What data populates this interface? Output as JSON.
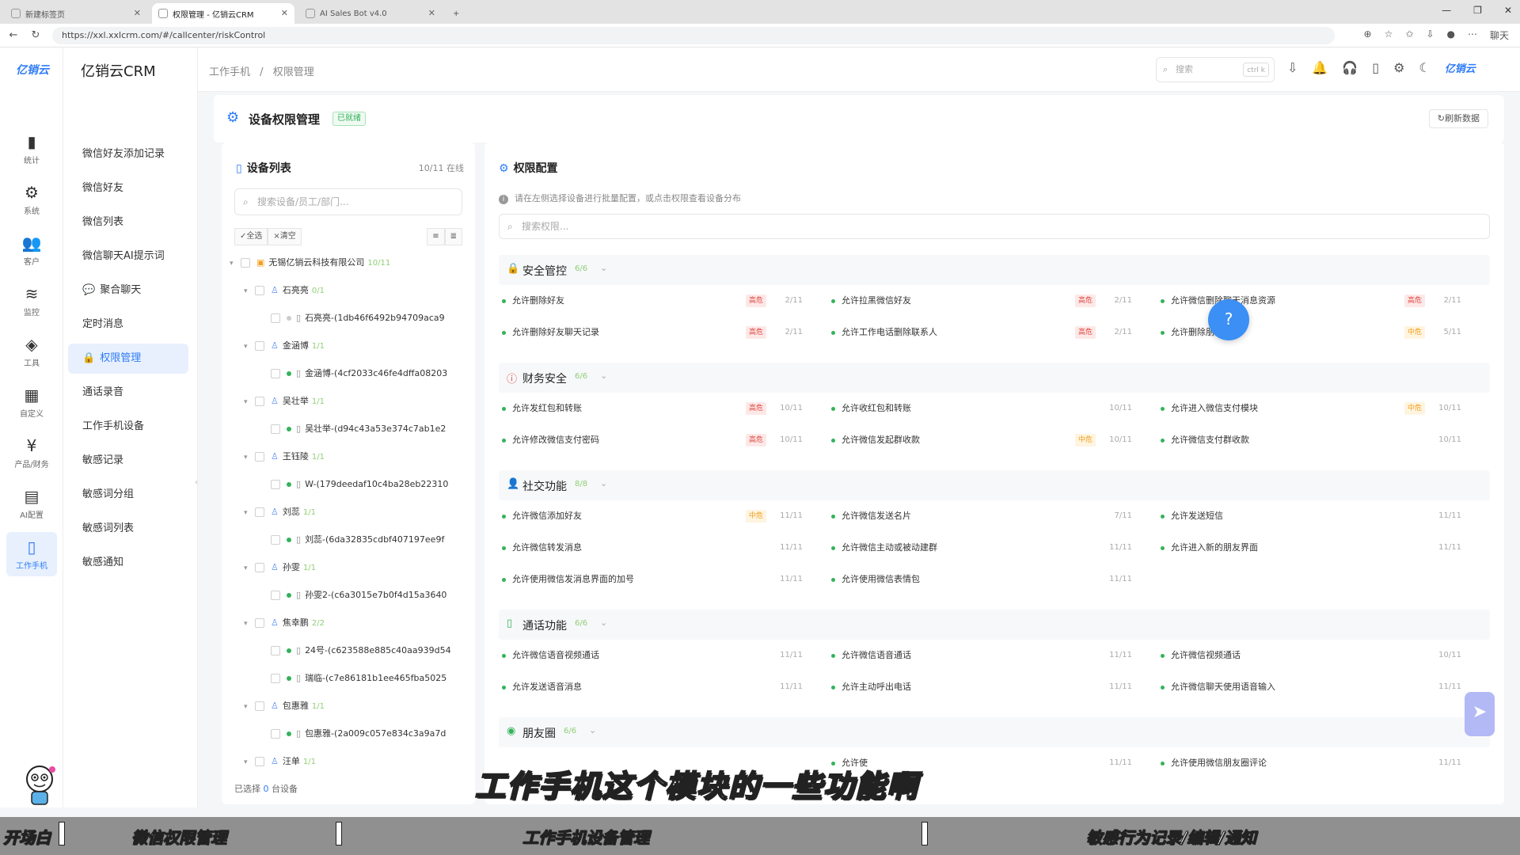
{
  "browser": {
    "tabs": [
      {
        "title": "新建标签页",
        "active": false
      },
      {
        "title": "权限管理 - 亿销云CRM",
        "active": true
      },
      {
        "title": "AI Sales Bot v4.0",
        "active": false
      }
    ],
    "url": "https://xxl.xxlcrm.com/#/callcenter/riskControl",
    "profile_label": "聊天"
  },
  "rail": {
    "logo": "亿销云",
    "items": [
      {
        "icon": "bar-chart-icon",
        "glyph": "▮",
        "label": "统计"
      },
      {
        "icon": "gear-icon",
        "glyph": "⚙",
        "label": "系统"
      },
      {
        "icon": "user-group-icon",
        "glyph": "👥",
        "label": "客户"
      },
      {
        "icon": "layers-icon",
        "glyph": "≋",
        "label": "监控"
      },
      {
        "icon": "cube-icon",
        "glyph": "◈",
        "label": "工具"
      },
      {
        "icon": "grid-icon",
        "glyph": "▦",
        "label": "自定义"
      },
      {
        "icon": "yen-icon",
        "glyph": "¥",
        "label": "产品/财务"
      },
      {
        "icon": "ai-config-icon",
        "glyph": "▤",
        "label": "AI配置"
      },
      {
        "icon": "phone-icon",
        "glyph": "▯",
        "label": "工作手机",
        "active": true
      }
    ]
  },
  "menu": {
    "brand": "亿销云CRM",
    "items": [
      {
        "label": "微信好友添加记录"
      },
      {
        "label": "微信好友"
      },
      {
        "label": "微信列表"
      },
      {
        "label": "微信聊天AI提示词"
      },
      {
        "label": "聚合聊天",
        "icon": "chat-icon",
        "glyph": "💬"
      },
      {
        "label": "定时消息"
      },
      {
        "label": "权限管理",
        "icon": "lock-icon",
        "glyph": "🔒",
        "active": true
      },
      {
        "label": "通话录音"
      },
      {
        "label": "工作手机设备"
      },
      {
        "label": "敏感记录"
      },
      {
        "label": "敏感词分组"
      },
      {
        "label": "敏感词列表"
      },
      {
        "label": "敏感通知"
      }
    ]
  },
  "header": {
    "breadcrumb": [
      "工作手机",
      "/",
      "权限管理"
    ],
    "search_placeholder": "搜索",
    "search_shortcut": "ctrl k",
    "logo": "亿销云"
  },
  "page": {
    "title": "设备权限管理",
    "status_badge": "已就绪",
    "refresh_label": "刷新数据"
  },
  "devices": {
    "title": "设备列表",
    "online": "10/11 在线",
    "search_placeholder": "搜索设备/员工/部门...",
    "select_all": "全选",
    "clear": "清空",
    "company": {
      "name": "无锡亿销云科技有限公司",
      "count": "10/11"
    },
    "groups": [
      {
        "name": "石亮亮",
        "count": "0/1",
        "devices": [
          "石亮亮-(1db46f6492b94709aca9"
        ],
        "online": false
      },
      {
        "name": "金涵博",
        "count": "1/1",
        "devices": [
          "金涵博-(4cf2033c46fe4dffa08203"
        ],
        "online": true
      },
      {
        "name": "吴壮举",
        "count": "1/1",
        "devices": [
          "吴壮举-(d94c43a53e374c7ab1e2"
        ],
        "online": true
      },
      {
        "name": "王钰陵",
        "count": "1/1",
        "devices": [
          "W-(179deedaf10c4ba28eb22310"
        ],
        "online": true
      },
      {
        "name": "刘蕊",
        "count": "1/1",
        "devices": [
          "刘蕊-(6da32835cdbf407197ee9f"
        ],
        "online": true
      },
      {
        "name": "孙雯",
        "count": "1/1",
        "devices": [
          "孙雯2-(c6a3015e7b0f4d15a3640"
        ],
        "online": true
      },
      {
        "name": "焦幸鹏",
        "count": "2/2",
        "devices": [
          "24号-(c623588e885c40aa939d54",
          "瑞临-(c7e86181b1ee465fba5025"
        ],
        "online": true
      },
      {
        "name": "包惠雅",
        "count": "1/1",
        "devices": [
          "包惠雅-(2a009c057e834c3a9a7d"
        ],
        "online": true
      },
      {
        "name": "汪单",
        "count": "1/1",
        "devices": [],
        "online": true
      }
    ],
    "selected_prefix": "已选择",
    "selected_count": "0",
    "selected_suffix": "台设备"
  },
  "perms": {
    "title": "权限配置",
    "hint": "请在左侧选择设备进行批量配置，或点击权限查看设备分布",
    "search_placeholder": "搜索权限...",
    "sections": [
      {
        "name": "安全管控",
        "ratio": "6/6",
        "icon": "lock-icon",
        "glyph": "🔒",
        "color": "#e0483f",
        "items": [
          {
            "label": "允许删除好友",
            "risk": "高危",
            "level": "high",
            "count": "2/11"
          },
          {
            "label": "允许拉黑微信好友",
            "risk": "高危",
            "level": "high",
            "count": "2/11"
          },
          {
            "label": "允许微信删除聊天消息资源",
            "risk": "高危",
            "level": "high",
            "count": "2/11"
          },
          {
            "label": "允许删除好友聊天记录",
            "risk": "高危",
            "level": "high",
            "count": "2/11"
          },
          {
            "label": "允许工作电话删除联系人",
            "risk": "高危",
            "level": "high",
            "count": "2/11"
          },
          {
            "label": "允许删除朋友圈",
            "risk": "中危",
            "level": "mid",
            "count": "5/11"
          }
        ]
      },
      {
        "name": "财务安全",
        "ratio": "6/6",
        "icon": "alert-circle-icon",
        "glyph": "ⓘ",
        "color": "#e0483f",
        "items": [
          {
            "label": "允许发红包和转账",
            "risk": "高危",
            "level": "high",
            "count": "10/11"
          },
          {
            "label": "允许收红包和转账",
            "risk": "",
            "level": "",
            "count": "10/11"
          },
          {
            "label": "允许进入微信支付模块",
            "risk": "中危",
            "level": "mid",
            "count": "10/11"
          },
          {
            "label": "允许修改微信支付密码",
            "risk": "高危",
            "level": "high",
            "count": "10/11"
          },
          {
            "label": "允许微信发起群收款",
            "risk": "中危",
            "level": "mid",
            "count": "10/11"
          },
          {
            "label": "允许微信支付群收款",
            "risk": "",
            "level": "",
            "count": "10/11"
          }
        ]
      },
      {
        "name": "社交功能",
        "ratio": "8/8",
        "icon": "user-icon",
        "glyph": "👤",
        "color": "#5b8def",
        "items": [
          {
            "label": "允许微信添加好友",
            "risk": "中危",
            "level": "mid",
            "count": "11/11"
          },
          {
            "label": "允许微信发送名片",
            "risk": "",
            "level": "",
            "count": "7/11"
          },
          {
            "label": "允许发送短信",
            "risk": "",
            "level": "",
            "count": "11/11"
          },
          {
            "label": "允许微信转发消息",
            "risk": "",
            "level": "",
            "count": "11/11"
          },
          {
            "label": "允许微信主动或被动建群",
            "risk": "",
            "level": "",
            "count": "11/11"
          },
          {
            "label": "允许进入新的朋友界面",
            "risk": "",
            "level": "",
            "count": "11/11"
          },
          {
            "label": "允许使用微信发消息界面的加号",
            "risk": "",
            "level": "",
            "count": "11/11"
          },
          {
            "label": "允许使用微信表情包",
            "risk": "",
            "level": "",
            "count": "11/11"
          }
        ]
      },
      {
        "name": "通话功能",
        "ratio": "6/6",
        "icon": "phone-icon",
        "glyph": "▯",
        "color": "#33b35a",
        "items": [
          {
            "label": "允许微信语音视频通话",
            "risk": "",
            "level": "",
            "count": "11/11"
          },
          {
            "label": "允许微信语音通话",
            "risk": "",
            "level": "",
            "count": "11/11"
          },
          {
            "label": "允许微信视频通话",
            "risk": "",
            "level": "",
            "count": "10/11"
          },
          {
            "label": "允许发送语音消息",
            "risk": "",
            "level": "",
            "count": "11/11"
          },
          {
            "label": "允许主动呼出电话",
            "risk": "",
            "level": "",
            "count": "11/11"
          },
          {
            "label": "允许微信聊天使用语音输入",
            "risk": "",
            "level": "",
            "count": "11/11"
          }
        ]
      },
      {
        "name": "朋友圈",
        "ratio": "6/6",
        "icon": "eye-icon",
        "glyph": "◉",
        "color": "#33b35a",
        "items": [
          {
            "label": "",
            "risk": "",
            "level": "",
            "count": ""
          },
          {
            "label": "允许使",
            "risk": "",
            "level": "",
            "count": "11/11"
          },
          {
            "label": "允许使用微信朋友圈评论",
            "risk": "",
            "level": "",
            "count": "11/11"
          }
        ]
      }
    ]
  },
  "overlay": {
    "subtitle": "工作手机这个模块的一些功能啊",
    "footer_chapters": [
      "开场白",
      "微信权限管理",
      "工作手机设备管理",
      "敏感行为记录/编辑/通知"
    ]
  },
  "colors": {
    "accent": "#2f7cf6",
    "online": "#33b35a",
    "danger": "#e0483f",
    "warning": "#f0a020"
  }
}
